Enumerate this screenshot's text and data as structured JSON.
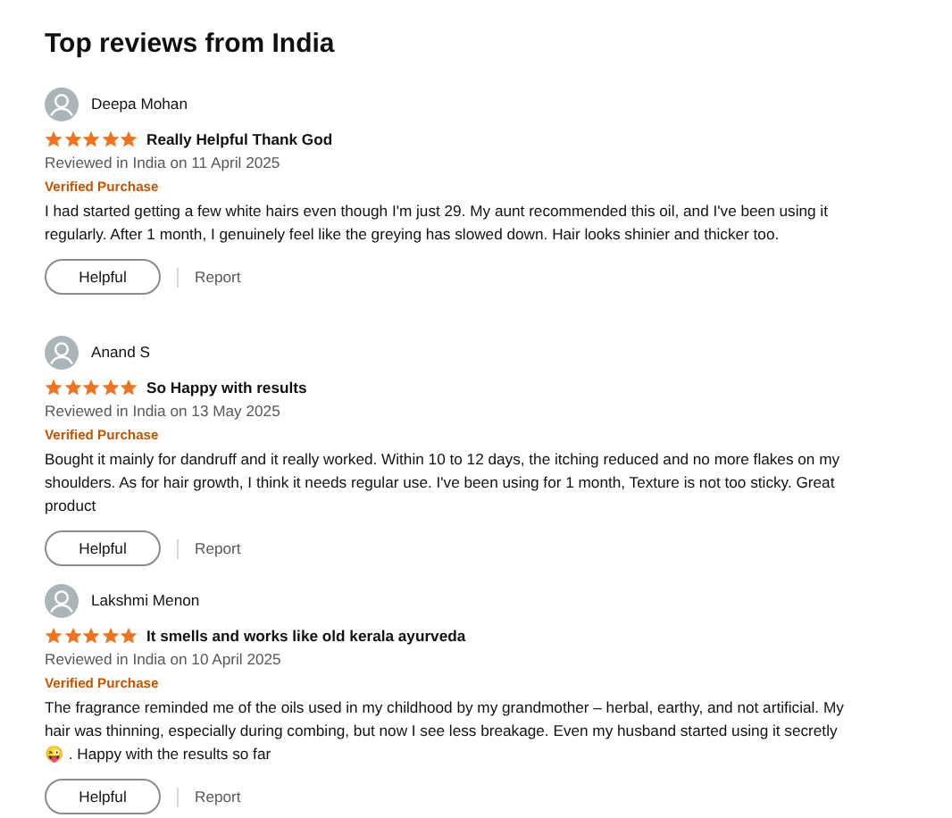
{
  "heading": "Top reviews from India",
  "reviews": [
    {
      "author": "Deepa Mohan",
      "stars": 5,
      "title": "Really Helpful Thank God",
      "date": "Reviewed in India on 11 April 2025",
      "badge": "Verified Purchase",
      "body": "I had started getting a few white hairs even though I'm just 29. My aunt recommended this oil, and I've been using it regularly. After 1 month, I genuinely feel like the greying has slowed down. Hair looks shinier and thicker too.",
      "helpful": "Helpful",
      "report": "Report"
    },
    {
      "author": "Anand S",
      "stars": 5,
      "title": "So Happy with results",
      "date": "Reviewed in India on 13 May 2025",
      "badge": "Verified Purchase",
      "body": "Bought it mainly for dandruff and it really worked. Within 10 to 12 days, the itching reduced and no more flakes on my shoulders. As for hair growth, I think it needs regular use. I've been using for 1 month, Texture is not too sticky. Great product",
      "helpful": "Helpful",
      "report": "Report"
    },
    {
      "author": "Lakshmi Menon",
      "stars": 5,
      "title": "It smells and works like old kerala ayurveda",
      "date": "Reviewed in India on 10 April 2025",
      "badge": "Verified Purchase",
      "body": "The fragrance reminded me of the oils used in my childhood by my grandmother – herbal, earthy, and not artificial. My hair was thinning, especially during combing, but now I see less breakage. Even my husband started using it secretly 😜 . Happy with the results so far",
      "helpful": "Helpful",
      "report": "Report"
    }
  ]
}
